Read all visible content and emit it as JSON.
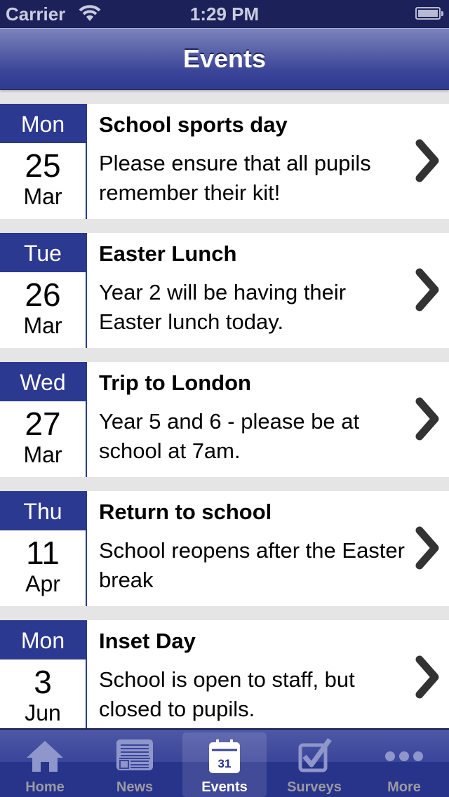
{
  "status_bar": {
    "carrier": "Carrier",
    "time": "1:29 PM",
    "wifi_icon": "wifi-icon",
    "battery_icon": "battery-icon"
  },
  "nav": {
    "title": "Events"
  },
  "events": [
    {
      "dow": "Mon",
      "day": "25",
      "month": "Mar",
      "title": "School sports day",
      "description": "Please ensure that all pupils remember their kit!"
    },
    {
      "dow": "Tue",
      "day": "26",
      "month": "Mar",
      "title": "Easter Lunch",
      "description": "Year 2 will be having their Easter lunch today."
    },
    {
      "dow": "Wed",
      "day": "27",
      "month": "Mar",
      "title": "Trip to London",
      "description": "Year 5 and 6 - please be at school at 7am."
    },
    {
      "dow": "Thu",
      "day": "11",
      "month": "Apr",
      "title": "Return to school",
      "description": "School reopens after the Easter break"
    },
    {
      "dow": "Mon",
      "day": "3",
      "month": "Jun",
      "title": "Inset Day",
      "description": "School is open to staff, but closed to pupils."
    }
  ],
  "tabs": [
    {
      "label": "Home",
      "icon": "home-icon"
    },
    {
      "label": "News",
      "icon": "newspaper-icon"
    },
    {
      "label": "Events",
      "icon": "calendar-icon",
      "icon_text": "31",
      "active": true
    },
    {
      "label": "Surveys",
      "icon": "checkbox-icon"
    },
    {
      "label": "More",
      "icon": "more-icon"
    }
  ],
  "colors": {
    "accent": "#2b3990",
    "status_bar": "#1c2259"
  }
}
